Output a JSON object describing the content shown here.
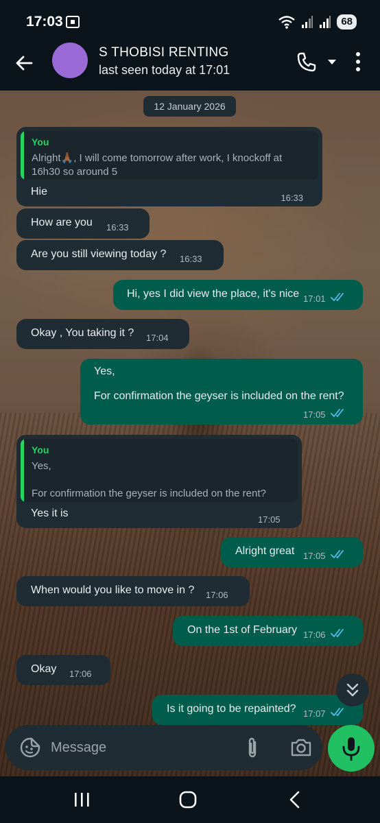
{
  "status_bar": {
    "time": "17:03",
    "battery": "68"
  },
  "header": {
    "contact_name": "S THOBISI RENTING",
    "contact_status": "last seen today at 17:01"
  },
  "chat": {
    "date_chip": "12 January 2026",
    "messages": [
      {
        "direction": "in",
        "quote_author": "You",
        "quote_line1": "Alright🙏🏾, I will come tomorrow after work, I knockoff at",
        "quote_line2": "16h30 so around 5",
        "text": "Hie",
        "time": "16:33"
      },
      {
        "direction": "in",
        "text": "How are you",
        "time": "16:33"
      },
      {
        "direction": "in",
        "text": "Are you still viewing today ?",
        "time": "16:33"
      },
      {
        "direction": "out",
        "text": "Hi, yes I did view the place, it's nice",
        "time": "17:01",
        "status": "read"
      },
      {
        "direction": "in",
        "text": "Okay , You taking it ?",
        "time": "17:04"
      },
      {
        "direction": "out",
        "line1": "Yes,",
        "line2": "For confirmation the geyser is included on the rent?",
        "time": "17:05",
        "status": "read"
      },
      {
        "direction": "in",
        "quote_author": "You",
        "quote_line1": "Yes,",
        "quote_line2": "For confirmation the geyser is included on the rent?",
        "text": "Yes it is",
        "time": "17:05"
      },
      {
        "direction": "out",
        "text": "Alright great",
        "time": "17:05",
        "status": "read"
      },
      {
        "direction": "in",
        "text": "When would you like to move in ?",
        "time": "17:06"
      },
      {
        "direction": "out",
        "text": "On the 1st of February",
        "time": "17:06",
        "status": "read"
      },
      {
        "direction": "in",
        "text": "Okay",
        "time": "17:06"
      },
      {
        "direction": "out",
        "text": "Is it going to be repainted?",
        "time": "17:07",
        "status": "read"
      }
    ]
  },
  "composer": {
    "placeholder": "Message"
  },
  "colors": {
    "header_bg": "#0b141a",
    "incoming_bubble": "#1f2c34",
    "outgoing_bubble": "#005c4b",
    "accent_green": "#25d366",
    "read_ticks": "#53bdeb",
    "avatar": "#9a6bd6"
  },
  "icons": [
    "back-arrow",
    "phone",
    "chevron-down",
    "more-vertical",
    "double-chevron-down",
    "sticker",
    "paperclip",
    "camera",
    "microphone",
    "recents",
    "home",
    "back"
  ]
}
